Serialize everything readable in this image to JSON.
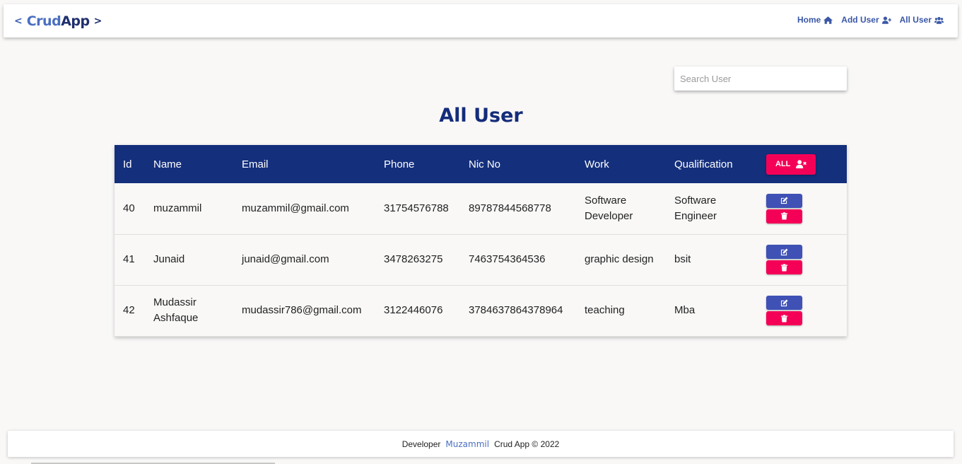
{
  "navbar": {
    "brand": {
      "prefix": "<",
      "crud": "Crud",
      "app": "App",
      "suffix": ">"
    },
    "links": [
      {
        "label": "Home",
        "icon": "home-icon"
      },
      {
        "label": "Add User",
        "icon": "user-plus-icon"
      },
      {
        "label": "All User",
        "icon": "users-icon"
      }
    ]
  },
  "search": {
    "placeholder": "Search User",
    "value": ""
  },
  "page": {
    "title": "All User"
  },
  "table": {
    "headers": [
      "Id",
      "Name",
      "Email",
      "Phone",
      "Nic No",
      "Work",
      "Qualification"
    ],
    "all_button": {
      "label": "ALL",
      "icon": "user-times-icon"
    },
    "rows": [
      {
        "id": "40",
        "name": "muzammil",
        "email": "muzammil@gmail.com",
        "phone": "31754576788",
        "nic": "89787844568778",
        "work": "Software Developer",
        "qualification": "Software Engineer"
      },
      {
        "id": "41",
        "name": "Junaid",
        "email": "junaid@gmail.com",
        "phone": "3478263275",
        "nic": "7463754364536",
        "work": "graphic design",
        "qualification": "bsit"
      },
      {
        "id": "42",
        "name": "Mudassir Ashfaque",
        "email": "mudassir786@gmail.com",
        "phone": "3122446076",
        "nic": "3784637864378964",
        "work": "teaching",
        "qualification": "Mba"
      }
    ],
    "row_actions": {
      "edit_icon": "edit-icon",
      "delete_icon": "trash-icon"
    }
  },
  "footer": {
    "prefix": "Developer",
    "developer": "Muzammil",
    "suffix": "Crud App © 2022"
  },
  "colors": {
    "primary": "#142f7c",
    "accent": "#f50057",
    "edit": "#3f51b5",
    "link": "#3a57a6"
  }
}
